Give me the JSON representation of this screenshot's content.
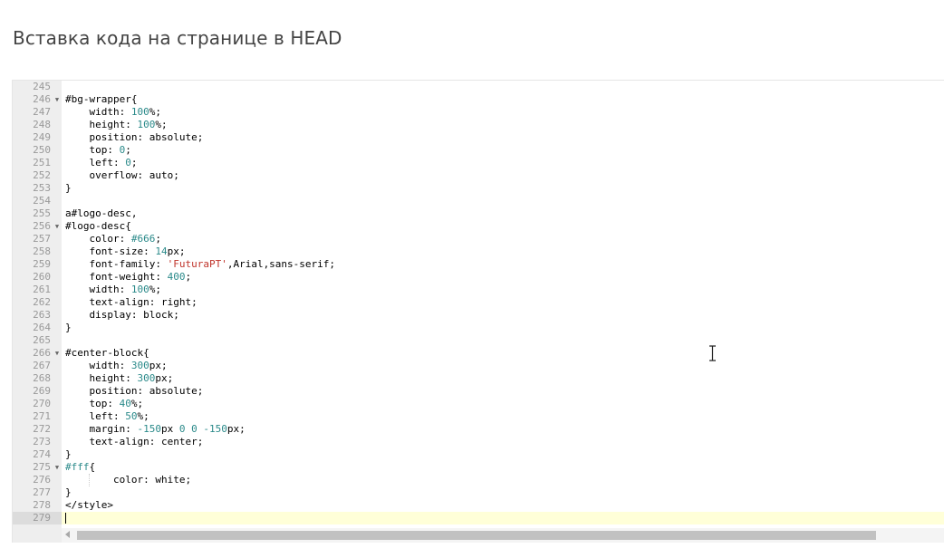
{
  "page": {
    "title": "Вставка кода на странице в HEAD"
  },
  "editor": {
    "lines": [
      {
        "n": "245",
        "fold": false,
        "code": ""
      },
      {
        "n": "246",
        "fold": true,
        "code": "#bg-wrapper{"
      },
      {
        "n": "247",
        "fold": false,
        "code": "    width: 100%;"
      },
      {
        "n": "248",
        "fold": false,
        "code": "    height: 100%;"
      },
      {
        "n": "249",
        "fold": false,
        "code": "    position: absolute;"
      },
      {
        "n": "250",
        "fold": false,
        "code": "    top: 0;"
      },
      {
        "n": "251",
        "fold": false,
        "code": "    left: 0;"
      },
      {
        "n": "252",
        "fold": false,
        "code": "    overflow: auto;"
      },
      {
        "n": "253",
        "fold": false,
        "code": "}"
      },
      {
        "n": "254",
        "fold": false,
        "code": ""
      },
      {
        "n": "255",
        "fold": false,
        "code": "a#logo-desc,"
      },
      {
        "n": "256",
        "fold": true,
        "code": "#logo-desc{"
      },
      {
        "n": "257",
        "fold": false,
        "code": "    color: #666;"
      },
      {
        "n": "258",
        "fold": false,
        "code": "    font-size: 14px;"
      },
      {
        "n": "259",
        "fold": false,
        "code": "    font-family: 'FuturaPT',Arial,sans-serif;"
      },
      {
        "n": "260",
        "fold": false,
        "code": "    font-weight: 400;"
      },
      {
        "n": "261",
        "fold": false,
        "code": "    width: 100%;"
      },
      {
        "n": "262",
        "fold": false,
        "code": "    text-align: right;"
      },
      {
        "n": "263",
        "fold": false,
        "code": "    display: block;"
      },
      {
        "n": "264",
        "fold": false,
        "code": "}"
      },
      {
        "n": "265",
        "fold": false,
        "code": ""
      },
      {
        "n": "266",
        "fold": true,
        "code": "#center-block{"
      },
      {
        "n": "267",
        "fold": false,
        "code": "    width: 300px;"
      },
      {
        "n": "268",
        "fold": false,
        "code": "    height: 300px;"
      },
      {
        "n": "269",
        "fold": false,
        "code": "    position: absolute;"
      },
      {
        "n": "270",
        "fold": false,
        "code": "    top: 40%;"
      },
      {
        "n": "271",
        "fold": false,
        "code": "    left: 50%;"
      },
      {
        "n": "272",
        "fold": false,
        "code": "    margin: -150px 0 0 -150px;"
      },
      {
        "n": "273",
        "fold": false,
        "code": "    text-align: center;"
      },
      {
        "n": "274",
        "fold": false,
        "code": "}"
      },
      {
        "n": "275",
        "fold": true,
        "code": "#fff{"
      },
      {
        "n": "276",
        "fold": false,
        "code": "        color: white;"
      },
      {
        "n": "277",
        "fold": false,
        "code": "}"
      },
      {
        "n": "278",
        "fold": false,
        "code": "</style>"
      },
      {
        "n": "279",
        "fold": false,
        "code": "",
        "active": true
      }
    ]
  },
  "icons": {
    "fold": "fold-arrow-icon",
    "scroll_left": "scroll-left-arrow-icon",
    "cursor": "text-cursor-icon"
  },
  "colors": {
    "number": "#2b8a8a",
    "string": "#c0342b",
    "gutter": "#eeeeee",
    "active_line": "#ffffd8"
  }
}
